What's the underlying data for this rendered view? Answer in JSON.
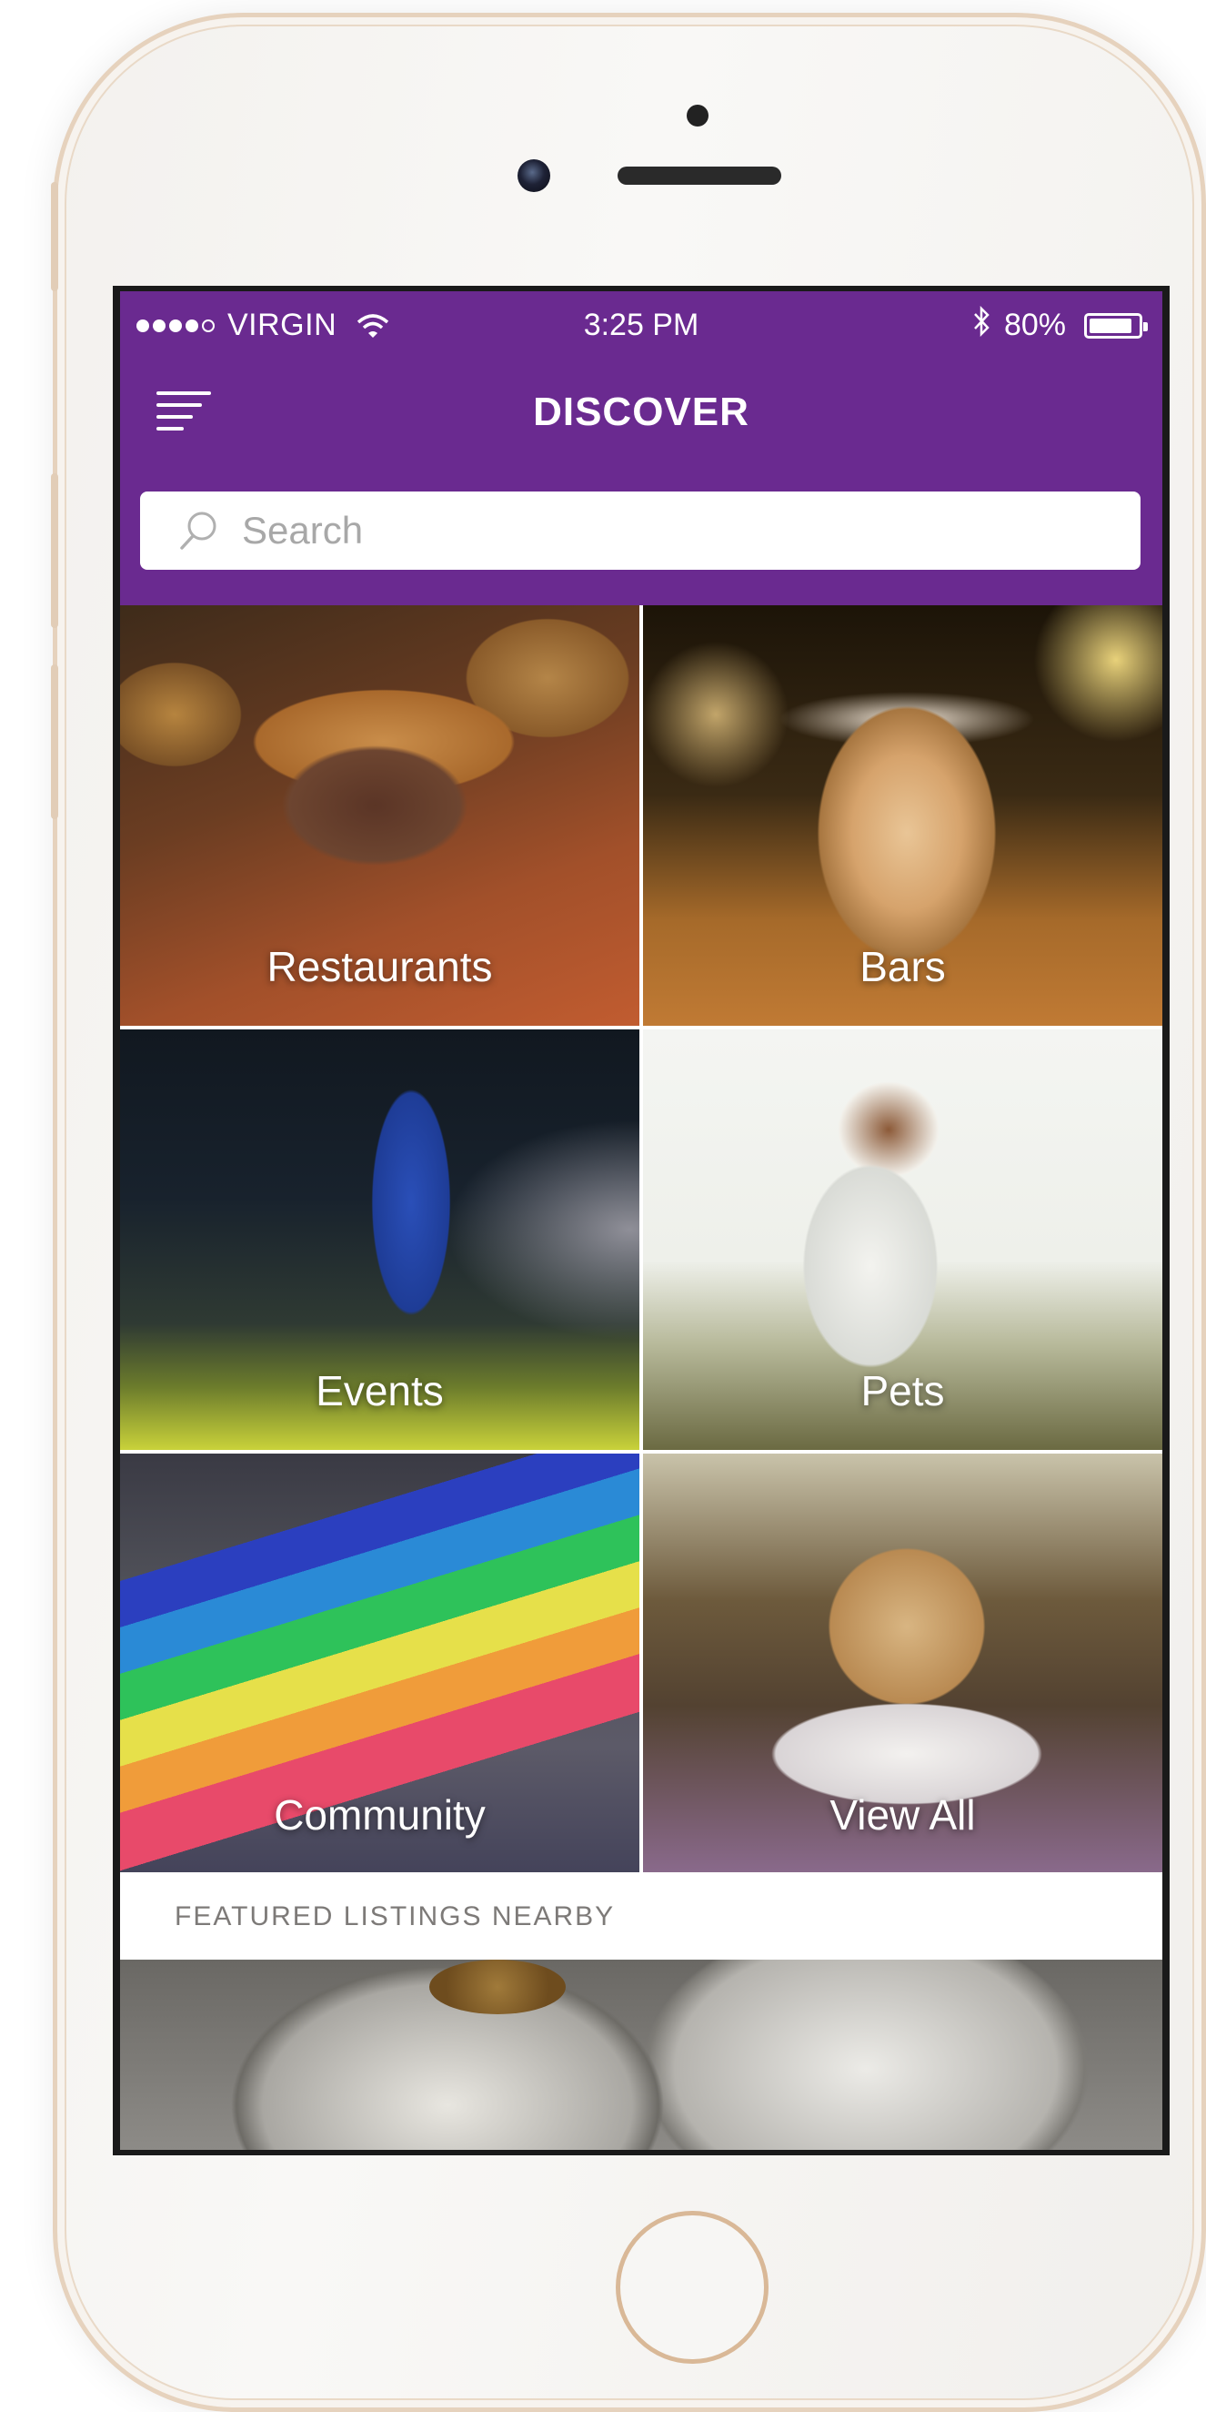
{
  "status_bar": {
    "carrier": "VIRGIN",
    "time": "3:25 PM",
    "battery": "80%",
    "battery_level": 0.8,
    "signal_bars": 4
  },
  "header": {
    "title": "DISCOVER",
    "color": "#6a2a90"
  },
  "search": {
    "placeholder": "Search"
  },
  "categories": [
    {
      "label": "Restaurants"
    },
    {
      "label": "Bars"
    },
    {
      "label": "Events"
    },
    {
      "label": "Pets"
    },
    {
      "label": "Community"
    },
    {
      "label": "View All"
    }
  ],
  "featured": {
    "heading": "FEATURED LISTINGS NEARBY"
  },
  "icons": [
    "menu-icon",
    "search-icon",
    "wifi-icon",
    "bluetooth-icon",
    "battery-icon"
  ]
}
